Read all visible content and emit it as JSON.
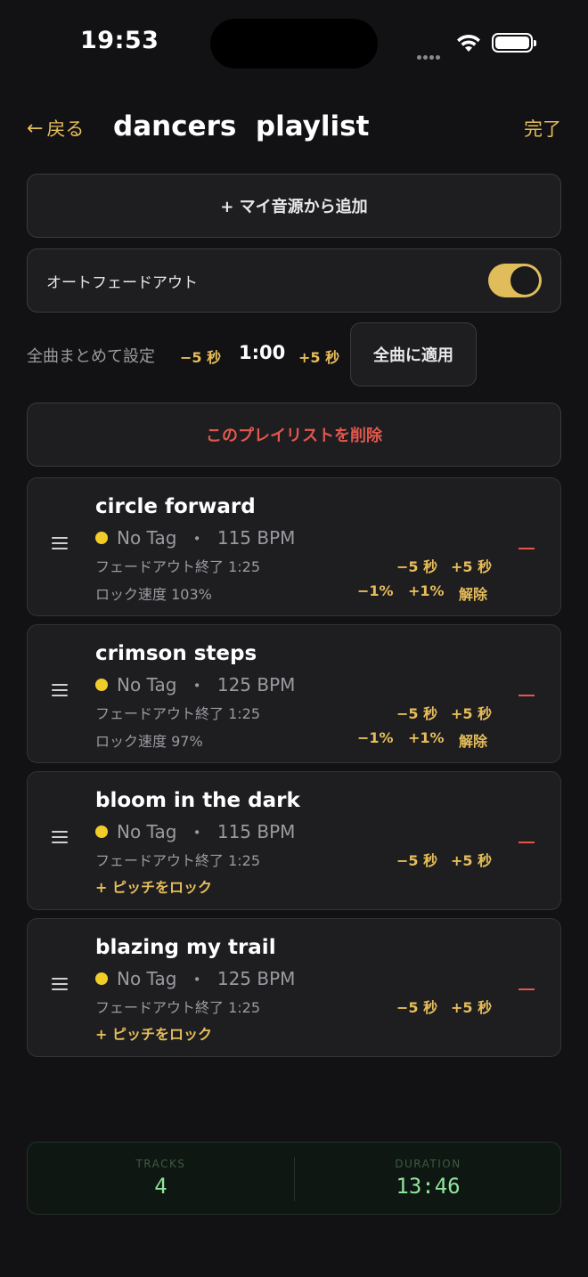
{
  "status": {
    "time": "19:53"
  },
  "header": {
    "back_label": "戻る",
    "title": "dancers  playlist",
    "done_label": "完了"
  },
  "add_button": "+ マイ音源から追加",
  "auto_fade": {
    "label": "オートフェードアウト",
    "enabled": true
  },
  "bulk": {
    "label": "全曲まとめて設定",
    "minus": "−5 秒",
    "value": "1:00",
    "plus": "+5 秒",
    "apply": "全曲に適用"
  },
  "delete_label": "このプレイリストを削除",
  "tracks": [
    {
      "name": "circle forward",
      "tag": "No Tag",
      "bpm": "115 BPM",
      "fade_end": "フェードアウト終了 1:25",
      "minus5": "−5 秒",
      "plus5": "+5 秒",
      "lock": "ロック速度 103%",
      "minus1": "−1%",
      "plus1": "+1%",
      "unlock": "解除"
    },
    {
      "name": "crimson steps",
      "tag": "No Tag",
      "bpm": "125 BPM",
      "fade_end": "フェードアウト終了 1:25",
      "minus5": "−5 秒",
      "plus5": "+5 秒",
      "lock": "ロック速度 97%",
      "minus1": "−1%",
      "plus1": "+1%",
      "unlock": "解除"
    },
    {
      "name": "bloom in the dark",
      "tag": "No Tag",
      "bpm": "115 BPM",
      "fade_end": "フェードアウト終了 1:25",
      "minus5": "−5 秒",
      "plus5": "+5 秒",
      "lock_pitch": "+ ピッチをロック"
    },
    {
      "name": "blazing my trail",
      "tag": "No Tag",
      "bpm": "125 BPM",
      "fade_end": "フェードアウト終了 1:25",
      "minus5": "−5 秒",
      "plus5": "+5 秒",
      "lock_pitch": "+ ピッチをロック"
    }
  ],
  "footer": {
    "tracks_label": "TRACKS",
    "tracks_value": "4",
    "duration_label": "DURATION",
    "duration_value": "13:46"
  },
  "colors": {
    "accent": "#e6bd5a",
    "danger": "#e2574c",
    "tag_dot": "#f2cd2a",
    "lcd": "#8fe39d"
  }
}
